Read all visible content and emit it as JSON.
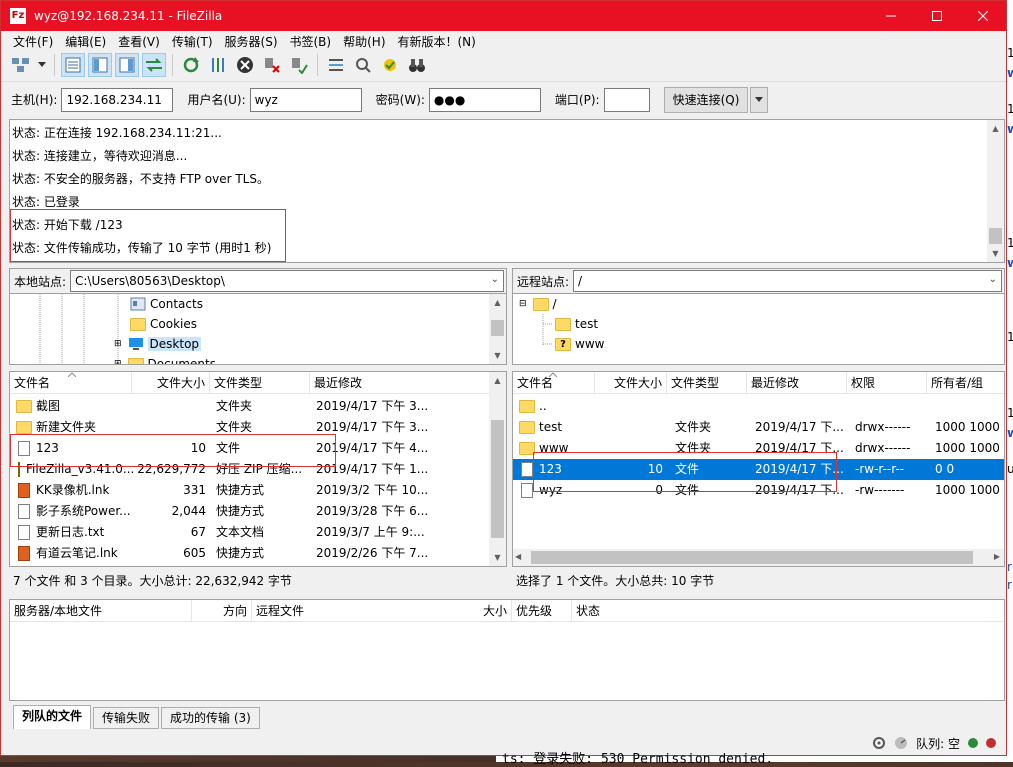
{
  "window": {
    "title": "wyz@192.168.234.11 - FileZilla",
    "app_icon": "Fz"
  },
  "menu": [
    "文件(F)",
    "编辑(E)",
    "查看(V)",
    "传输(T)",
    "服务器(S)",
    "书签(B)",
    "帮助(H)",
    "有新版本！(N)"
  ],
  "quickconnect": {
    "host_label": "主机(H):",
    "host_value": "192.168.234.11",
    "user_label": "用户名(U):",
    "user_value": "wyz",
    "pass_label": "密码(W):",
    "pass_value": "●●●",
    "port_label": "端口(P):",
    "port_value": "",
    "button": "快速连接(Q)"
  },
  "log": [
    "状态: 正在连接 192.168.234.11:21...",
    "状态: 连接建立，等待欢迎消息...",
    "状态: 不安全的服务器，不支持 FTP over TLS。",
    "状态: 已登录",
    "状态: 开始下载 /123",
    "状态: 文件传输成功，传输了 10 字节 (用时1 秒)"
  ],
  "local": {
    "site_label": "本地站点:",
    "path": "C:\\Users\\80563\\Desktop\\",
    "tree": [
      "Contacts",
      "Cookies",
      "Desktop",
      "Documents"
    ],
    "columns": [
      "文件名",
      "文件大小",
      "文件类型",
      "最近修改"
    ],
    "files": [
      {
        "name": "截图",
        "size": "",
        "type": "文件夹",
        "modified": "2019/4/17 下午 3..."
      },
      {
        "name": "新建文件夹",
        "size": "",
        "type": "文件夹",
        "modified": "2019/4/17 下午 3..."
      },
      {
        "name": "123",
        "size": "10",
        "type": "文件",
        "modified": "2019/4/17 下午 4..."
      },
      {
        "name": "FileZilla_v3.41.0...",
        "size": "22,629,772",
        "type": "好压 ZIP 压缩...",
        "modified": "2019/4/17 下午 1..."
      },
      {
        "name": "KK录像机.lnk",
        "size": "331",
        "type": "快捷方式",
        "modified": "2019/3/2 下午 10..."
      },
      {
        "name": "影子系统Power...",
        "size": "2,044",
        "type": "快捷方式",
        "modified": "2019/3/28 下午 6..."
      },
      {
        "name": "更新日志.txt",
        "size": "67",
        "type": "文本文档",
        "modified": "2019/3/7 上午 9:..."
      },
      {
        "name": "有道云笔记.lnk",
        "size": "605",
        "type": "快捷方式",
        "modified": "2019/2/26 下午 7..."
      }
    ],
    "status": "7 个文件 和 3 个目录。大小总计: 22,632,942 字节"
  },
  "remote": {
    "site_label": "远程站点:",
    "path": "/",
    "tree": [
      "/",
      "test",
      "www"
    ],
    "columns": [
      "文件名",
      "文件大小",
      "文件类型",
      "最近修改",
      "权限",
      "所有者/组"
    ],
    "files": [
      {
        "name": "..",
        "size": "",
        "type": "",
        "modified": "",
        "perm": "",
        "owner": ""
      },
      {
        "name": "test",
        "size": "",
        "type": "文件夹",
        "modified": "2019/4/17 下...",
        "perm": "drwx------",
        "owner": "1000 1000"
      },
      {
        "name": "www",
        "size": "",
        "type": "文件夹",
        "modified": "2019/4/17 下...",
        "perm": "drwx------",
        "owner": "1000 1000"
      },
      {
        "name": "123",
        "size": "10",
        "type": "文件",
        "modified": "2019/4/17 下...",
        "perm": "-rw-r--r--",
        "owner": "0 0"
      },
      {
        "name": "wyz",
        "size": "0",
        "type": "文件",
        "modified": "2019/4/17 下...",
        "perm": "-rw-------",
        "owner": "1000 1000"
      }
    ],
    "status": "选择了 1 个文件。大小总共: 10 字节"
  },
  "queue": {
    "columns": [
      "服务器/本地文件",
      "方向",
      "远程文件",
      "大小",
      "优先级",
      "状态"
    ],
    "tabs": [
      "列队的文件",
      "传输失败",
      "成功的传输 (3)"
    ]
  },
  "bottom": {
    "queue_label": "队列: 空"
  },
  "background": {
    "terminal_text": "ts: 登录失败: 530 Permission denied.",
    "side_chars": [
      "1",
      "w",
      "1",
      "w",
      "1",
      "w",
      "1",
      "1",
      "w",
      "u",
      "r",
      "r"
    ]
  },
  "colors": {
    "titlebar": "#e81123",
    "selection": "#0078d7",
    "highlight_box": "#e03030"
  }
}
